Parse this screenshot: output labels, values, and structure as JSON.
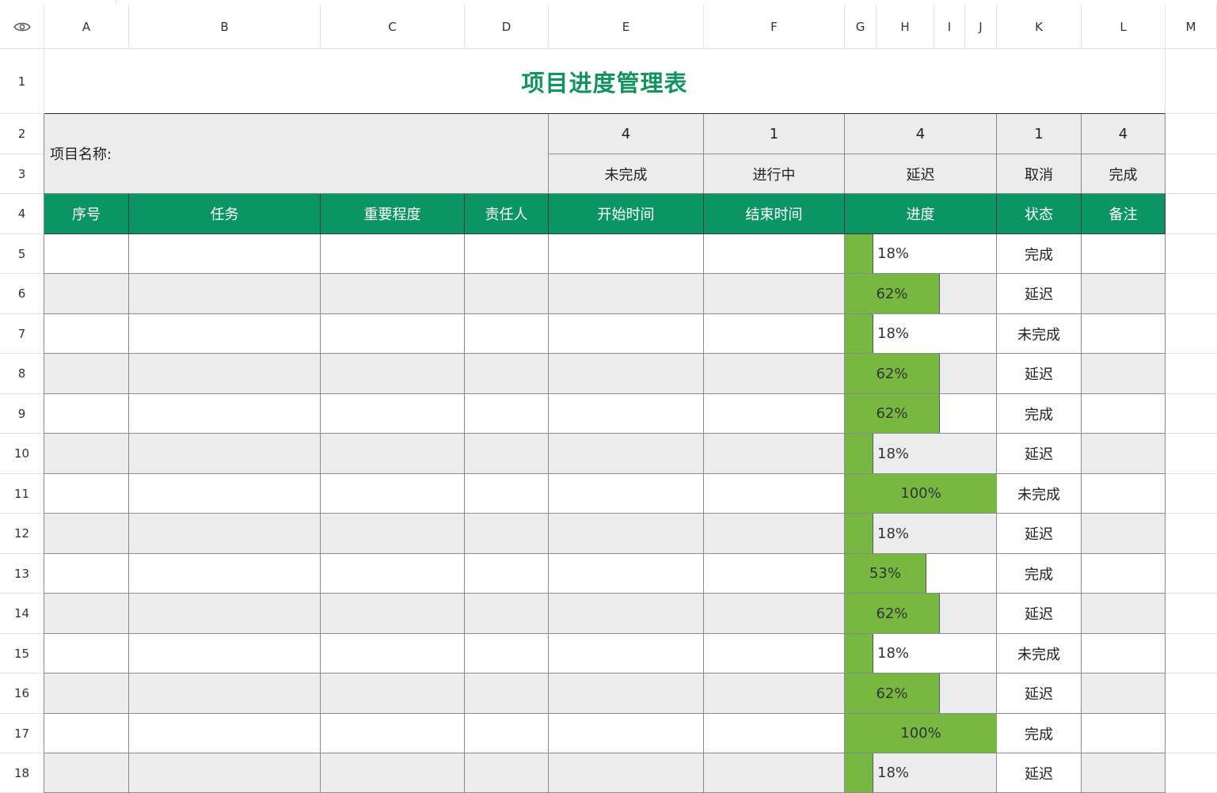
{
  "columns": [
    "A",
    "B",
    "C",
    "D",
    "E",
    "F",
    "G",
    "H",
    "I",
    "J",
    "K",
    "L",
    "M"
  ],
  "rows": [
    "1",
    "2",
    "3",
    "4",
    "5",
    "6",
    "7",
    "8",
    "9",
    "10",
    "11",
    "12",
    "13",
    "14",
    "15",
    "16",
    "17",
    "18"
  ],
  "title": "项目进度管理表",
  "project_name_label": "项目名称:",
  "summary": {
    "counts": [
      "4",
      "1",
      "4",
      "1",
      "4"
    ],
    "labels": [
      "未完成",
      "进行中",
      "延迟",
      "取消",
      "完成"
    ]
  },
  "headers": [
    "序号",
    "任务",
    "重要程度",
    "责任人",
    "开始时间",
    "结束时间",
    "进度",
    "状态",
    "备注"
  ],
  "tasks": [
    {
      "progress": 0.18,
      "progress_label": "18%",
      "status": "完成"
    },
    {
      "progress": 0.62,
      "progress_label": "62%",
      "status": "延迟"
    },
    {
      "progress": 0.18,
      "progress_label": "18%",
      "status": "未完成"
    },
    {
      "progress": 0.62,
      "progress_label": "62%",
      "status": "延迟"
    },
    {
      "progress": 0.62,
      "progress_label": "62%",
      "status": "完成"
    },
    {
      "progress": 0.18,
      "progress_label": "18%",
      "status": "延迟"
    },
    {
      "progress": 1.0,
      "progress_label": "100%",
      "status": "未完成"
    },
    {
      "progress": 0.18,
      "progress_label": "18%",
      "status": "延迟"
    },
    {
      "progress": 0.53,
      "progress_label": "53%",
      "status": "完成"
    },
    {
      "progress": 0.62,
      "progress_label": "62%",
      "status": "延迟"
    },
    {
      "progress": 0.18,
      "progress_label": "18%",
      "status": "未完成"
    },
    {
      "progress": 0.62,
      "progress_label": "62%",
      "status": "延迟"
    },
    {
      "progress": 1.0,
      "progress_label": "100%",
      "status": "完成"
    },
    {
      "progress": 0.18,
      "progress_label": "18%",
      "status": "延迟"
    }
  ],
  "colors": {
    "title": "#13935e",
    "header_fill": "#0b9464",
    "progress_fill": "#77b843",
    "band_gray": "#ececec"
  },
  "icons": {
    "corner": "eye-icon"
  }
}
